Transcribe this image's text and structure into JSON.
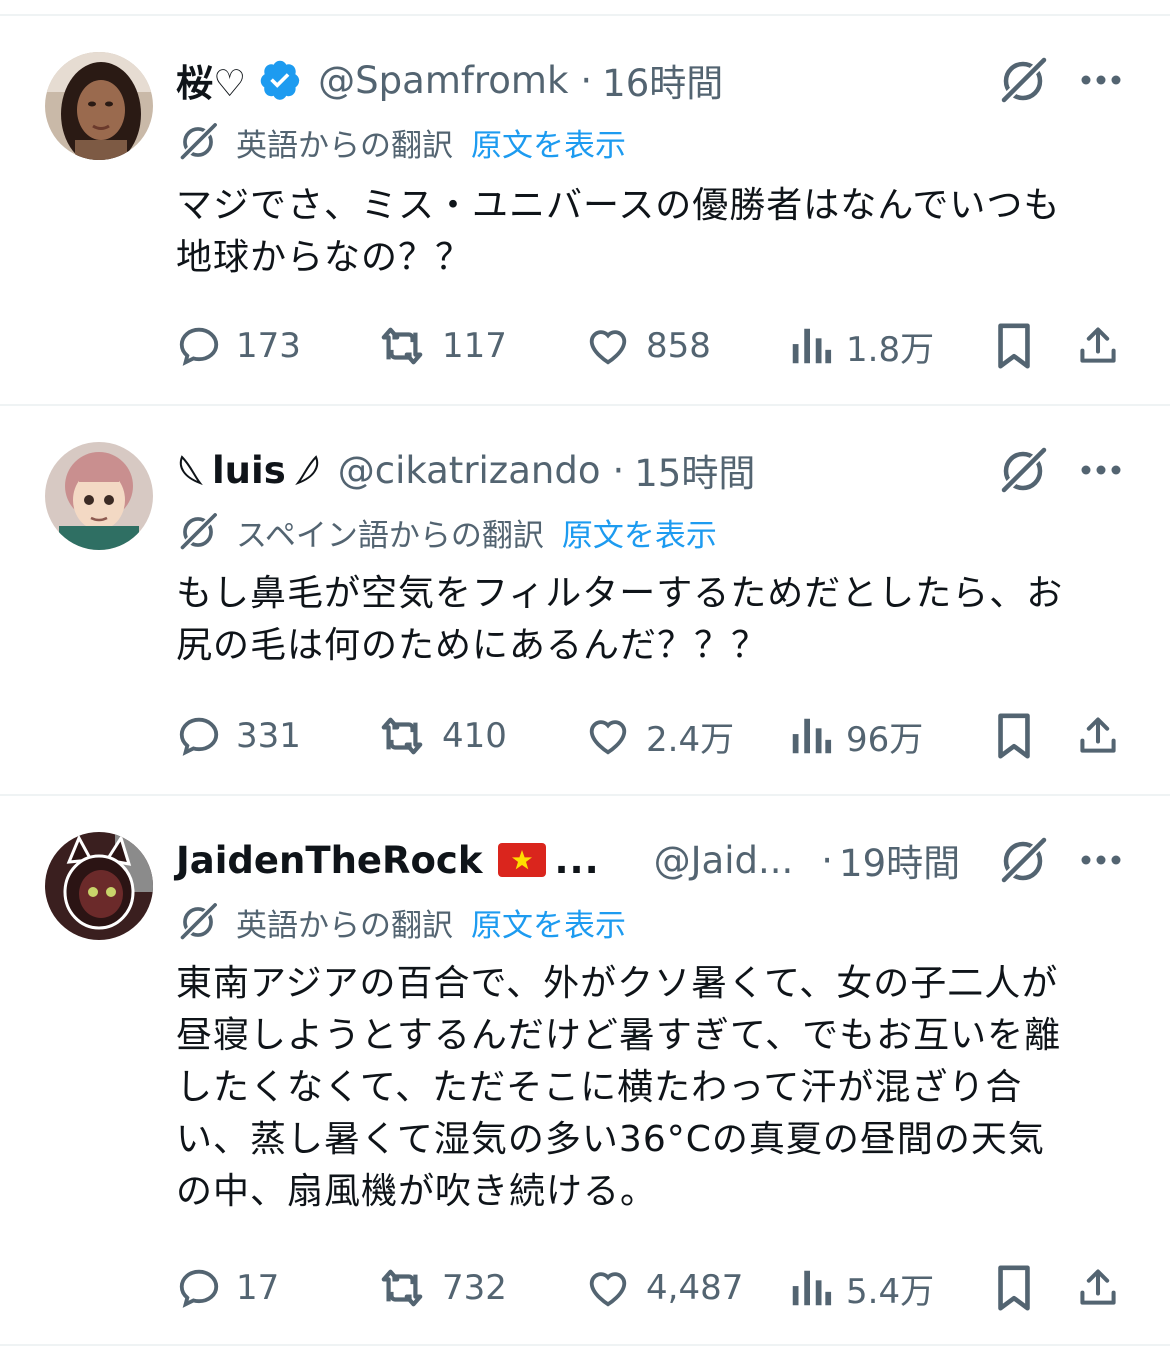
{
  "tweets": [
    {
      "display_name": "桜♡",
      "verified": true,
      "handle": "@Spamfromk",
      "separator": "·",
      "time": "16時間",
      "translation_label": "英語からの翻訳",
      "show_original": "原文を表示",
      "body_lines": [
        "マジでさ、ミス・ユニバースの優勝者はなんでいつも",
        "地球からなの？？"
      ],
      "replies": "173",
      "reposts": "117",
      "likes": "858",
      "views": "1.8万"
    },
    {
      "display_name": "luis",
      "handle": "@cikatrizando",
      "separator": "·",
      "time": "15時間",
      "translation_label": "スペイン語からの翻訳",
      "show_original": "原文を表示",
      "body_lines": [
        "もし鼻毛が空気をフィルターするためだとしたら、お",
        "尻の毛は何のためにあるんだ？？？"
      ],
      "replies": "331",
      "reposts": "410",
      "likes": "2.4万",
      "views": "96万"
    },
    {
      "display_name": "JaidenTheRock",
      "name_ellipsis": "...",
      "handle": "@Jaid...",
      "separator": "·",
      "time": "19時間",
      "translation_label": "英語からの翻訳",
      "show_original": "原文を表示",
      "body_lines": [
        "東南アジアの百合で、外がクソ暑くて、女の子二人が",
        "昼寝しようとするんだけど暑すぎて、でもお互いを離",
        "したくなくて、ただそこに横たわって汗が混ざり合",
        "い、蒸し暑くて湿気の多い36°Cの真夏の昼間の天気",
        "の中、扇風機が吹き続ける。"
      ],
      "replies": "17",
      "reposts": "732",
      "likes": "4,487",
      "views": "5.4万"
    }
  ],
  "colors": {
    "text": "#0f1419",
    "secondary": "#536471",
    "link": "#1d9bf0",
    "verified": "#1d9bf0",
    "divider": "#eff3f4",
    "flag": "#da251d"
  },
  "icons": [
    "verified-badge-icon",
    "grok-icon",
    "more-icon",
    "translate-icon",
    "reply-icon",
    "repost-icon",
    "like-icon",
    "views-icon",
    "bookmark-icon",
    "share-icon",
    "vietnam-flag-icon",
    "leaf-icon"
  ]
}
